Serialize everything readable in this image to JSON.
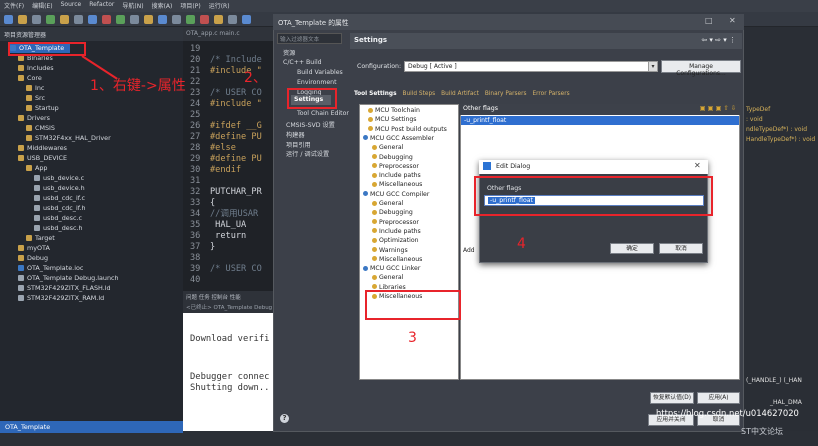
{
  "ide": {
    "menu": [
      "文件(F)",
      "编辑(E)",
      "Source",
      "Refactor",
      "导航(N)",
      "搜索(A)",
      "项目(P)",
      "运行(R)"
    ],
    "project_header": "项目资源管理器",
    "editor_tabs": "OTA_app.c   main.c",
    "status_project": "OTA_Template",
    "console_tabs": "问题  任务  控制台  性能",
    "console_sub": "<已终止> OTA_Template Debug",
    "console_lines": [
      "Download verifi",
      "Debugger connec",
      "Shutting down.."
    ]
  },
  "tree": [
    {
      "label": "OTA_Template",
      "selected": true
    },
    {
      "label": "Binaries"
    },
    {
      "label": "Includes"
    },
    {
      "label": "Core"
    },
    {
      "label": "Inc"
    },
    {
      "label": "Src"
    },
    {
      "label": "Startup"
    },
    {
      "label": "Drivers"
    },
    {
      "label": "CMSIS"
    },
    {
      "label": "STM32F4xx_HAL_Driver"
    },
    {
      "label": "Middlewares"
    },
    {
      "label": "USB_DEVICE"
    },
    {
      "label": "App"
    },
    {
      "label": "usb_device.c"
    },
    {
      "label": "usb_device.h"
    },
    {
      "label": "usbd_cdc_if.c"
    },
    {
      "label": "usbd_cdc_if.h"
    },
    {
      "label": "usbd_desc.c"
    },
    {
      "label": "usbd_desc.h"
    },
    {
      "label": "Target"
    },
    {
      "label": "myOTA"
    },
    {
      "label": "Debug"
    },
    {
      "label": "OTA_Template.ioc"
    },
    {
      "label": "OTA_Template Debug.launch"
    },
    {
      "label": "STM32F429ZITX_FLASH.ld"
    },
    {
      "label": "STM32F429ZITX_RAM.ld"
    }
  ],
  "code": [
    {
      "n": "19",
      "t": ""
    },
    {
      "n": "20",
      "t": "/* Include"
    },
    {
      "n": "21",
      "t": "#include \""
    },
    {
      "n": "22",
      "t": ""
    },
    {
      "n": "23",
      "t": "/* USER CO"
    },
    {
      "n": "24",
      "t": "#include \""
    },
    {
      "n": "25",
      "t": ""
    },
    {
      "n": "26",
      "t": "#ifdef __G"
    },
    {
      "n": "27",
      "t": "#define PU"
    },
    {
      "n": "28",
      "t": "#else"
    },
    {
      "n": "29",
      "t": "#define PU"
    },
    {
      "n": "30",
      "t": "#endif"
    },
    {
      "n": "31",
      "t": ""
    },
    {
      "n": "32",
      "t": "PUTCHAR_PR"
    },
    {
      "n": "33",
      "t": "{"
    },
    {
      "n": "34",
      "t": "//调用USAR"
    },
    {
      "n": "35",
      "t": "    HAL_UA"
    },
    {
      "n": "36",
      "t": "    return"
    },
    {
      "n": "37",
      "t": "}"
    },
    {
      "n": "38",
      "t": ""
    },
    {
      "n": "39",
      "t": "/* USER CO"
    },
    {
      "n": "40",
      "t": ""
    }
  ],
  "right_ide": {
    "lines": [
      "TypeDef",
      ": void",
      "ndleTypeDef*) : void",
      "HandleTypeDef*) : void"
    ],
    "bottom_lines": [
      "(_HANDLE_) (_HAN",
      "_HAL_DMA"
    ]
  },
  "props": {
    "title": "OTA_Template 的属性",
    "filter_placeholder": "输入过滤器文本",
    "nav": [
      "资源",
      "C/C++ Build",
      "Build Variables",
      "Environment",
      "Logging",
      "Settings",
      "Tool Chain Editor",
      "CMSIS-SVD 设置",
      "构建器",
      "项目引用",
      "运行 / 调试设置"
    ],
    "nav_selected": "Settings",
    "settings_header": "Settings",
    "config_label": "Configuration:",
    "config_value": "Debug  [ Active ]",
    "manage_btn": "Manage Configurations...",
    "subtabs": [
      "Tool Settings",
      "Build Steps",
      "Build Artifact",
      "Binary Parsers",
      "Error Parsers"
    ],
    "tool_tree": [
      "MCU Toolchain",
      "MCU Settings",
      "MCU Post build outputs",
      "MCU GCC Assembler",
      "General",
      "Debugging",
      "Preprocessor",
      "Include paths",
      "Miscellaneous",
      "MCU GCC Compiler",
      "General",
      "Debugging",
      "Preprocessor",
      "Include paths",
      "Optimization",
      "Warnings",
      "Miscellaneous",
      "MCU GCC Linker",
      "General",
      "Libraries",
      "Miscellaneous"
    ],
    "opt_header": "Other flags",
    "opt_value": "-u_printf_float",
    "opt_add": "Add",
    "restore_btn": "恢复默认值(D)",
    "apply_btn": "应用(A)",
    "apply_close_btn": "应用并关闭",
    "cancel_btn": "取消"
  },
  "edit_dialog": {
    "title": "Edit Dialog",
    "label": "Other flags",
    "value": "-u_printf_float",
    "ok": "确定",
    "cancel": "取消"
  },
  "annotations": {
    "step1": "1、右键->属性",
    "step2": "2、",
    "step3": "3",
    "step4": "4",
    "color": "#e8242b"
  },
  "watermark": {
    "url": "https://blog.csdn.net/u014627020",
    "forum": "ST中文论坛"
  }
}
